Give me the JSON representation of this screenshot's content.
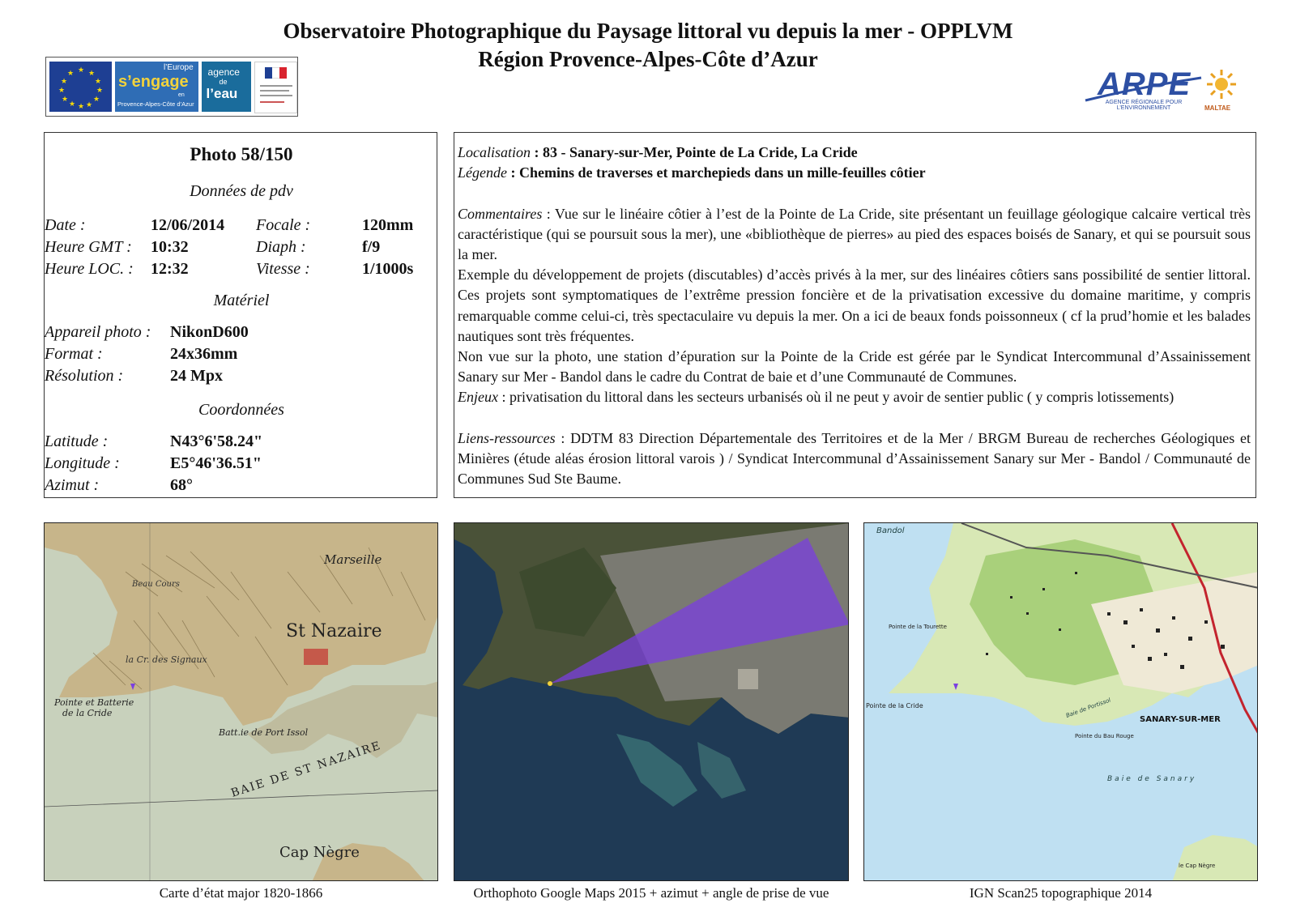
{
  "header": {
    "title_line1": "Observatoire Photographique du Paysage littoral vu depuis la mer - OPPLVM",
    "title_line2": "Région Provence-Alpes-Côte d’Azur"
  },
  "logos": {
    "europe_line1": "l’Europe",
    "europe_line2": "s’engage",
    "europe_line3": "en",
    "europe_line4": "Provence-Alpes-Côte d’Azur",
    "agence": "agence",
    "agence_de": "de",
    "agence_eau": "l’eau",
    "arpe": "ARPE",
    "arpe_sub": "AGENCE RÉGIONALE POUR L’ENVIRONNEMENT",
    "maltae": "MALTAE"
  },
  "photo": {
    "number": "Photo 58/150",
    "section_pdv": "Données de pdv",
    "date_label": "Date :",
    "date_value": "12/06/2014",
    "gmt_label": "Heure GMT :",
    "gmt_value": "10:32",
    "loc_label": "Heure LOC. :",
    "loc_value": "12:32",
    "focale_label": "Focale :",
    "focale_value": "120mm",
    "diaph_label": "Diaph :",
    "diaph_value": "f/9",
    "vitesse_label": "Vitesse :",
    "vitesse_value": "1/1000s",
    "section_materiel": "Matériel",
    "appareil_label": "Appareil photo :",
    "appareil_value": "NikonD600",
    "format_label": "Format :",
    "format_value": "24x36mm",
    "resolution_label": "Résolution :",
    "resolution_value": "24 Mpx",
    "section_coord": "Coordonnées",
    "latitude_label": "Latitude :",
    "latitude_value": "N43°6'58.24\"",
    "longitude_label": "Longitude :",
    "longitude_value": "E5°46'36.51\"",
    "azimut_label": "Azimut :",
    "azimut_value": "68°"
  },
  "description": {
    "localisation_label": "Localisation",
    "localisation_value": ": 83 - Sanary-sur-Mer, Pointe de La Cride, La Cride",
    "legende_label": "Légende",
    "legende_value": ": Chemins de traverses et marchepieds dans un mille-feuilles côtier",
    "commentaires_label": "Commentaires",
    "commentaires_p1": " : Vue sur le linéaire côtier à l’est de la Pointe de La Cride, site présentant un feuillage géologique calcaire vertical très caractéristique (qui se poursuit sous la mer), une «bibliothèque de pierres» au pied des espaces boisés de Sanary, et qui se poursuit sous la mer.",
    "commentaires_p2": "Exemple du développement de projets (discutables) d’accès privés à la mer, sur des linéaires côtiers sans possibilité de sentier littoral. Ces projets sont symptomatiques de l’extrême pression foncière et de la privatisation excessive du domaine maritime, y compris remarquable comme celui-ci, très spectaculaire vu depuis la mer. On a ici de beaux fonds poissonneux ( cf la prud’homie et les balades nautiques sont très fréquentes.",
    "commentaires_p3": "Non vue sur la photo, une station d’épuration sur la Pointe de la Cride est gérée par le Syndicat Intercommunal d’Assainissement Sanary sur Mer - Bandol dans le cadre du Contrat de baie et d’une Communauté de Communes.",
    "enjeux_label": "Enjeux",
    "enjeux_value": " : privatisation du littoral dans les secteurs urbanisés où il ne peut y avoir de sentier public ( y compris lotissements)",
    "liens_label": "Liens-ressources",
    "liens_value": " : DDTM 83 Direction Départementale des Territoires et de la Mer  / BRGM Bureau de recherches Géologiques et Minières (étude aléas érosion littoral varois ) / Syndicat Intercommunal d’Assainissement Sanary sur Mer - Bandol / Communauté de Communes Sud Ste Baume."
  },
  "maps": {
    "map1_labels": {
      "st_nazaire": "St Nazaire",
      "marseille": "Marseille",
      "beau_cours": "Beau Cours",
      "la_cride": "la Cr. des Signaux",
      "pointe_batterie": "Pointe et Batterie",
      "de_la_cride": "de la Cride",
      "port_issol": "Batt.ie de Port Issol",
      "baie": "BAIE DE ST NAZAIRE",
      "cap_negre": "Cap Nègre"
    },
    "map3_labels": {
      "bandol": "Bandol",
      "pointe_tourette": "Pointe de la Tourette",
      "pointe_cride": "Pointe de la Cride",
      "baie_portissol": "Baie de Portissol",
      "bau_rouge": "Pointe du Bau Rouge",
      "sanary": "SANARY-SUR-MER",
      "baie_sanary": "Baie de Sanary",
      "cap_negre": "le Cap Nègre"
    },
    "caption1": "Carte d’état major 1820-1866",
    "caption2": "Orthophoto Google Maps 2015 + azimut + angle de prise de vue",
    "caption3": "IGN Scan25 topographique 2014"
  },
  "colors": {
    "eu_blue": "#1e3f93",
    "arpe_blue": "#2d4fa3",
    "view_cone": "#7b3fe0",
    "old_map_sea": "#cfd8c2",
    "old_map_land": "#c9b98e",
    "topo_sea": "#bfe0f2",
    "topo_land": "#d8e8b5"
  }
}
